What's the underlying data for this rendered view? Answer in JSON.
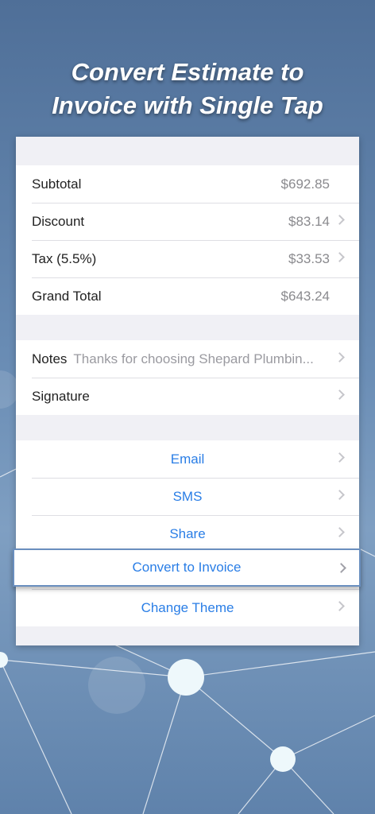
{
  "headline": {
    "line1": "Convert Estimate to",
    "line2": "Invoice with Single Tap"
  },
  "totals": [
    {
      "label": "Subtotal",
      "value": "$692.85",
      "chevron": false
    },
    {
      "label": "Discount",
      "value": "$83.14",
      "chevron": true
    },
    {
      "label": "Tax (5.5%)",
      "value": "$33.53",
      "chevron": true
    },
    {
      "label": "Grand Total",
      "value": "$643.24",
      "chevron": false
    }
  ],
  "details": {
    "notes_label": "Notes",
    "notes_value": "Thanks for choosing Shepard Plumbin...",
    "signature_label": "Signature"
  },
  "actions": {
    "email": "Email",
    "sms": "SMS",
    "share": "Share",
    "convert": "Convert to Invoice",
    "theme": "Change Theme"
  },
  "colors": {
    "accent": "#2a7ee6",
    "background": "#5f82ab"
  }
}
